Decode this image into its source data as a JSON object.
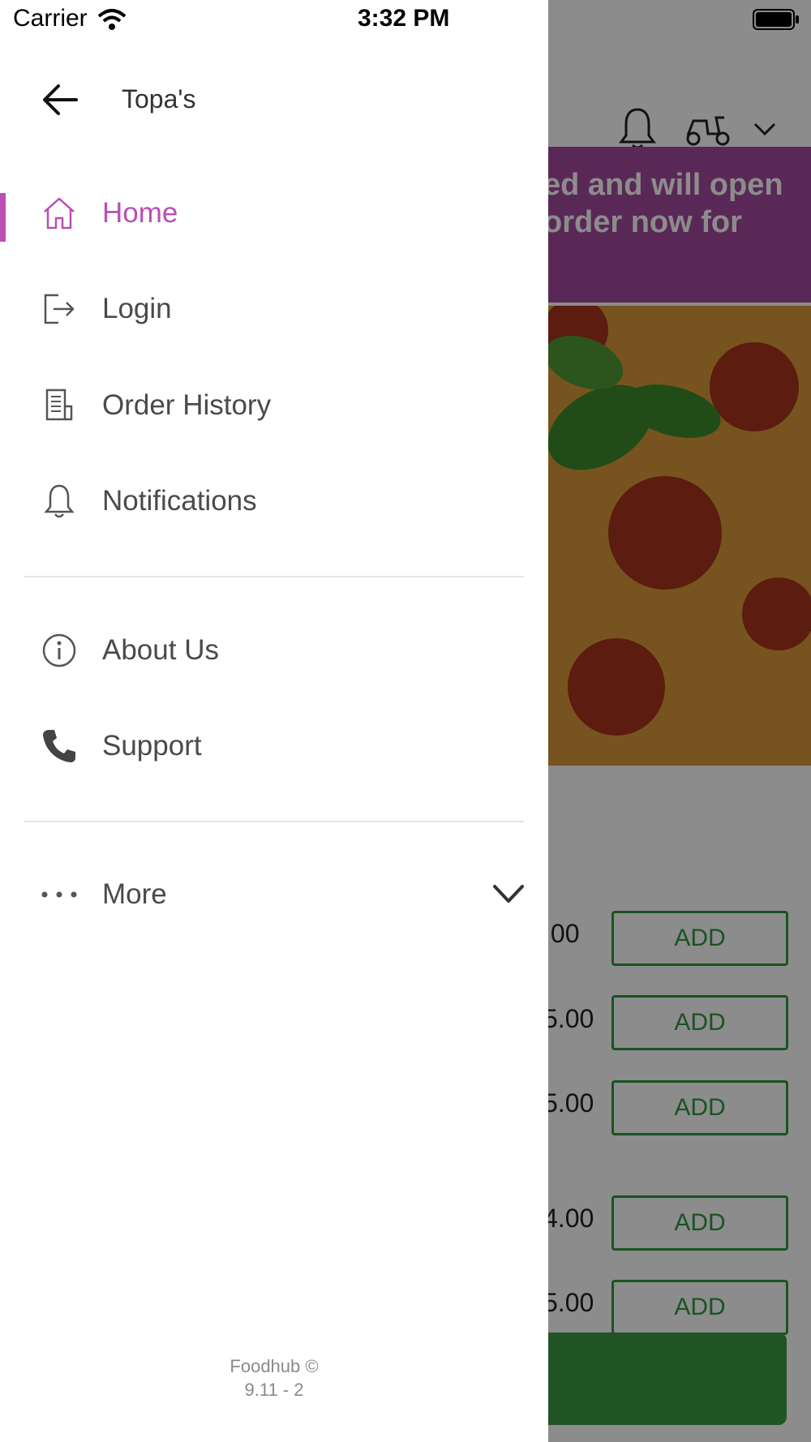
{
  "status_bar": {
    "carrier": "Carrier",
    "time": "3:32 PM"
  },
  "background_app": {
    "banner_lines": [
      "ed and will open",
      "order now for"
    ],
    "prices": [
      ".00",
      "5.00",
      "5.00",
      "4.00",
      "5.00"
    ],
    "add_label": "ADD"
  },
  "drawer": {
    "store_name": "Topa's",
    "items": [
      {
        "label": "Home",
        "icon": "home-icon"
      },
      {
        "label": "Login",
        "icon": "login-icon"
      },
      {
        "label": "Order History",
        "icon": "receipt-icon"
      },
      {
        "label": "Notifications",
        "icon": "bell-icon"
      },
      {
        "label": "About Us",
        "icon": "info-icon"
      },
      {
        "label": "Support",
        "icon": "phone-icon"
      },
      {
        "label": "More",
        "icon": "more-dots-icon"
      }
    ],
    "footer_line1": "Foodhub ©",
    "footer_line2": "9.11 - 2"
  },
  "colors": {
    "accent": "#b94fb4",
    "banner": "#a44a9d",
    "add_green": "#2e9a3e"
  }
}
